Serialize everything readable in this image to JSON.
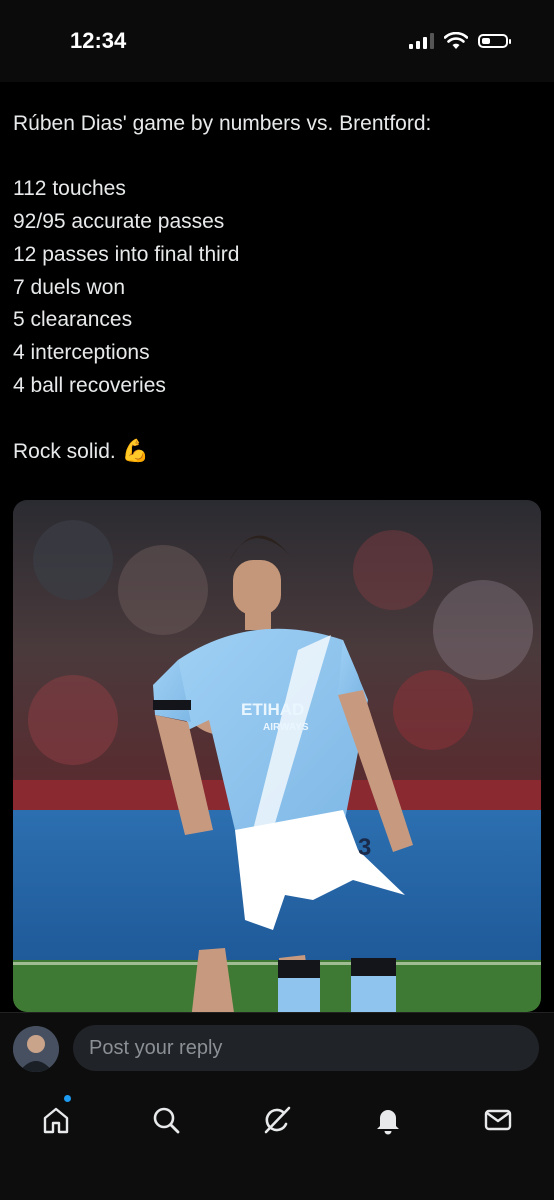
{
  "status_bar": {
    "time": "12:34"
  },
  "tweet": {
    "lines": [
      "Rúben Dias' game by numbers vs. Brentford:",
      "112 touches",
      "92/95 accurate passes",
      "12 passes into final third",
      "7 duels won",
      "5 clearances",
      "4 interceptions",
      "4 ball recoveries",
      "Rock solid."
    ],
    "emoji": "💪"
  },
  "media": {
    "kit_sponsor_line1": "ETIHAD",
    "kit_sponsor_line2": "AIRWAYS",
    "shirt_number": "3"
  },
  "reply": {
    "placeholder": "Post your reply"
  },
  "tabs": [
    "home-icon",
    "search-icon",
    "grok-icon",
    "notifications-icon",
    "messages-icon"
  ],
  "colors": {
    "accent": "#1d9bf0",
    "background": "#000000",
    "input": "#202327",
    "city_blue": "#8fc4ee"
  }
}
